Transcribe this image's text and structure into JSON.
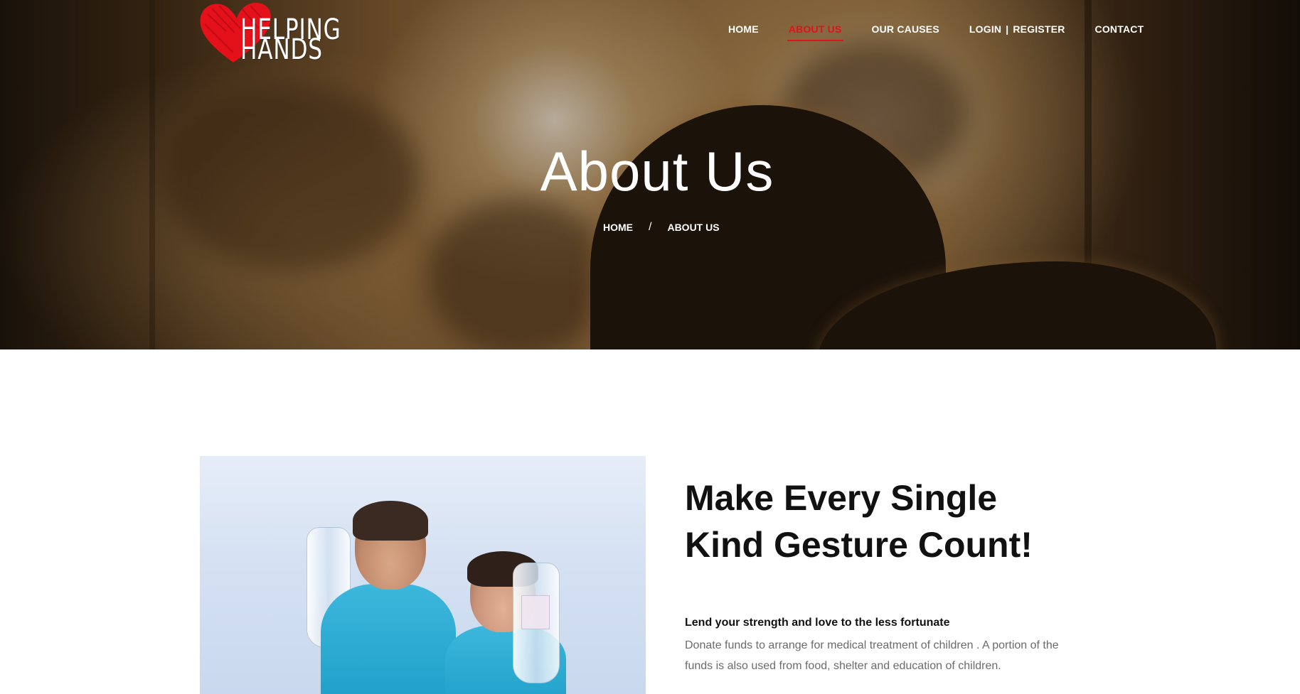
{
  "logo": {
    "line1": "HELPING",
    "line2": "HANDS",
    "heart_color": "#e4111b"
  },
  "nav": {
    "items": [
      {
        "label": "HOME",
        "active": false
      },
      {
        "label": "ABOUT US",
        "active": true
      },
      {
        "label": "OUR CAUSES",
        "active": false
      },
      {
        "label": "LOGIN",
        "active": false
      },
      {
        "label": "REGISTER",
        "active": false
      },
      {
        "label": "CONTACT",
        "active": false
      }
    ],
    "separator": "|",
    "active_color": "#e4111b"
  },
  "hero": {
    "title": "About Us",
    "breadcrumb": {
      "home": "HOME",
      "separator": "/",
      "current": "ABOUT US"
    }
  },
  "content": {
    "headline_line1": "Make Every Single",
    "headline_line2": "Kind Gesture Count!",
    "subheading": "Lend your strength and love to the less fortunate",
    "body": "Donate funds to arrange for medical treatment of children . A portion of the funds is also used from food, shelter and education of children."
  }
}
